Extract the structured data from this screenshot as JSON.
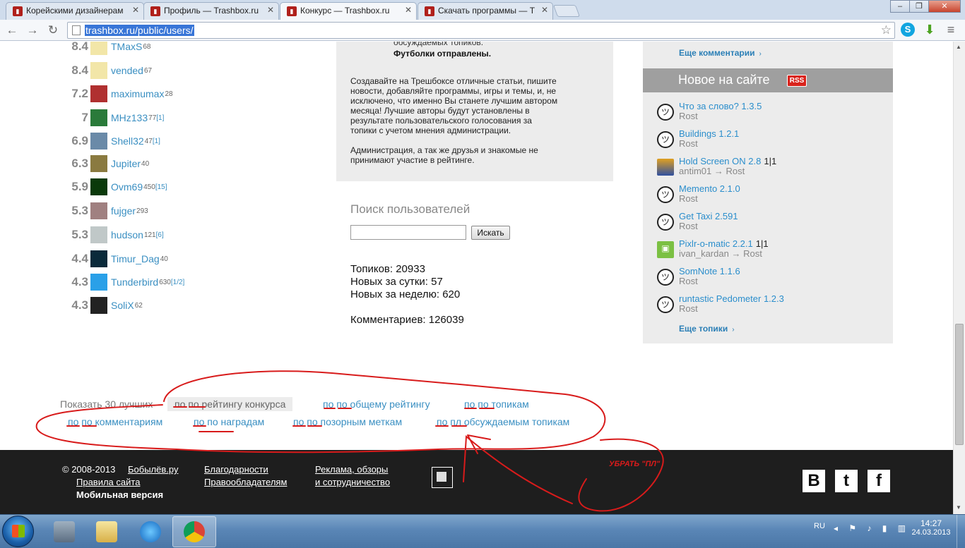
{
  "browser": {
    "tabs": [
      {
        "title": "Корейскими дизайнерам",
        "active": false
      },
      {
        "title": "Профиль — Trashbox.ru",
        "active": false
      },
      {
        "title": "Конкурс — Trashbox.ru",
        "active": true
      },
      {
        "title": "Скачать программы — Т",
        "active": false
      }
    ],
    "url": "trashbox.ru/public/users/",
    "window_buttons": {
      "minimize": "–",
      "maximize": "❐",
      "close": "✕"
    }
  },
  "ranking": [
    {
      "score": "8.4",
      "name": "TMaxS",
      "sup": "68",
      "sup_link": "",
      "avatar_color": "#f2e6a8"
    },
    {
      "score": "8.4",
      "name": "vended",
      "sup": "67",
      "sup_link": "",
      "avatar_color": "#f2e6a8"
    },
    {
      "score": "7.2",
      "name": "maximumax",
      "sup": "28",
      "sup_link": "",
      "avatar_color": "#b03030"
    },
    {
      "score": "7",
      "name": "MHz133",
      "sup": "77",
      "sup_link": "[1]",
      "avatar_color": "#2a7a3a"
    },
    {
      "score": "6.9",
      "name": "Shell32",
      "sup": "47",
      "sup_link": "[1]",
      "avatar_color": "#6a8aa8"
    },
    {
      "score": "6.3",
      "name": "Jupiter",
      "sup": "40",
      "sup_link": "",
      "avatar_color": "#8a7a40"
    },
    {
      "score": "5.9",
      "name": "Ovm69",
      "sup": "450",
      "sup_link": "[15]",
      "avatar_color": "#0b3a0b"
    },
    {
      "score": "5.3",
      "name": "fujger",
      "sup": "293",
      "sup_link": "",
      "avatar_color": "#a08080"
    },
    {
      "score": "5.3",
      "name": "hudson",
      "sup": "121",
      "sup_link": "[6]",
      "avatar_color": "#c0c8c8"
    },
    {
      "score": "4.4",
      "name": "Timur_Dag",
      "sup": "40",
      "sup_link": "",
      "avatar_color": "#0a2a3a"
    },
    {
      "score": "4.3",
      "name": "Tunderbird",
      "sup": "630",
      "sup_link": "[1/2]",
      "avatar_color": "#2aa0e8"
    },
    {
      "score": "4.3",
      "name": "SoliX",
      "sup": "62",
      "sup_link": "",
      "avatar_color": "#222222"
    }
  ],
  "contest": {
    "fragment": "обсуждаемых топиков.",
    "bold": "Футболки отправлены.",
    "para1_lines": [
      "Создавайте на Трешбоксе отличные статьи, пишите",
      "новости, добавляйте программы, игры и темы, и, не",
      "исключено, что именно Вы станете лучшим автором",
      "месяца! Лучшие авторы будут установлены в",
      "результате пользовательского голосования за",
      "топики с учетом мнения администрации."
    ],
    "para2_lines": [
      "Администрация, а так же друзья и знакомые не",
      "принимают участие в рейтинге."
    ]
  },
  "search": {
    "title": "Поиск пользователей",
    "button": "Искать",
    "placeholder": ""
  },
  "stats": {
    "topics": "Топиков: 20933",
    "new_day": "Новых за сутки: 57",
    "new_week": "Новых за неделю: 620",
    "comments": "Комментариев: 126039"
  },
  "sidebar": {
    "more_comments": "Еще комментарии",
    "new_title": "Новое на сайте",
    "rss": "RSS",
    "more_topics": "Еще топики",
    "news": [
      {
        "title": "Что за слово? 1.3.5",
        "count": "",
        "author": "Rost",
        "editor": "",
        "icon": "troll"
      },
      {
        "title": "Buildings 1.2.1",
        "count": "",
        "author": "Rost",
        "editor": "",
        "icon": "troll"
      },
      {
        "title": "Hold Screen ON 2.8",
        "count": "1|1",
        "author": "antim01",
        "editor": "Rost",
        "icon": "photo"
      },
      {
        "title": "Memento 2.1.0",
        "count": "",
        "author": "Rost",
        "editor": "",
        "icon": "troll"
      },
      {
        "title": "Get Taxi 2.591",
        "count": "",
        "author": "Rost",
        "editor": "",
        "icon": "troll"
      },
      {
        "title": "Pixlr-o-matic 2.2.1",
        "count": "1|1",
        "author": "ivan_kardan",
        "editor": "Rost",
        "icon": "android"
      },
      {
        "title": "SomNote 1.1.6",
        "count": "",
        "author": "Rost",
        "editor": "",
        "icon": "troll"
      },
      {
        "title": "runtastic Pedometer 1.2.3",
        "count": "",
        "author": "Rost",
        "editor": "",
        "icon": "troll"
      }
    ]
  },
  "filters": {
    "label": "Показать 30 лучших",
    "items": [
      {
        "label": "по по рейтингу конкурса",
        "active": true
      },
      {
        "label": "по по общему рейтингу",
        "active": false
      },
      {
        "label": "по по топикам",
        "active": false
      },
      {
        "label": "по по комментариям",
        "active": false
      },
      {
        "label": "по по наградам",
        "active": false
      },
      {
        "label": "по по позорным меткам",
        "active": false
      },
      {
        "label": "по пл обсуждаемым топикам",
        "active": false
      }
    ]
  },
  "footer": {
    "copyright": "© 2008-2013",
    "author": "Бобылёв.ру",
    "rules": "Правила сайта",
    "mobile": "Мобильная версия",
    "thanks": "Благодарности",
    "rightholders": "Правообладателям",
    "ads1": "Реклама, обзоры",
    "ads2": "и сотрудничество",
    "note": "УБРАТЬ \"ПЛ\"",
    "social": [
      "B",
      "t",
      "f"
    ]
  },
  "taskbar": {
    "lang": "RU",
    "time": "14:27",
    "date": "24.03.2013"
  },
  "colors": {
    "link": "#3a8fc2",
    "annotation": "#d81b1b",
    "footer_bg": "#1e1e1e",
    "panel_bg": "#ececec"
  }
}
